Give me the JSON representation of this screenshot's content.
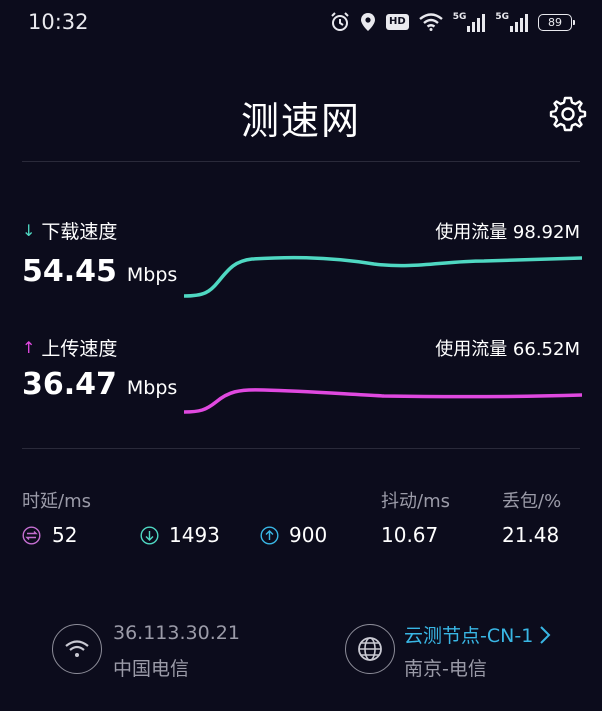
{
  "status_bar": {
    "time": "10:32",
    "hd_label": "HD",
    "net1_label": "5G",
    "net2_label": "5G",
    "battery": "89"
  },
  "header": {
    "title": "测速网"
  },
  "download": {
    "label": "下载速度",
    "usage": "使用流量 98.92M",
    "value": "54.45",
    "unit": "Mbps",
    "color": "#4fd8c2"
  },
  "upload": {
    "label": "上传速度",
    "usage": "使用流量 66.52M",
    "value": "36.47",
    "unit": "Mbps",
    "color": "#e049e0"
  },
  "stats": {
    "latency_label": "时延/ms",
    "jitter_label": "抖动/ms",
    "loss_label": "丢包/%",
    "idle_latency": "52",
    "download_latency": "1493",
    "upload_latency": "900",
    "jitter": "10.67",
    "packet_loss": "21.48"
  },
  "footer": {
    "ip": "36.113.30.21",
    "isp": "中国电信",
    "node": "云测节点-CN-1",
    "node_location": "南京-电信",
    "link_color": "#39b6e4"
  },
  "icons": {
    "status": [
      "alarm-icon",
      "location-icon",
      "hd-icon",
      "wifi-icon",
      "signal-icon",
      "signal-icon",
      "battery-icon"
    ],
    "header": [
      "gear-icon"
    ],
    "stats": [
      "idle-latency-icon",
      "download-latency-icon",
      "upload-latency-icon"
    ],
    "footer": [
      "wifi-icon",
      "globe-icon",
      "chevron-right-icon"
    ]
  }
}
